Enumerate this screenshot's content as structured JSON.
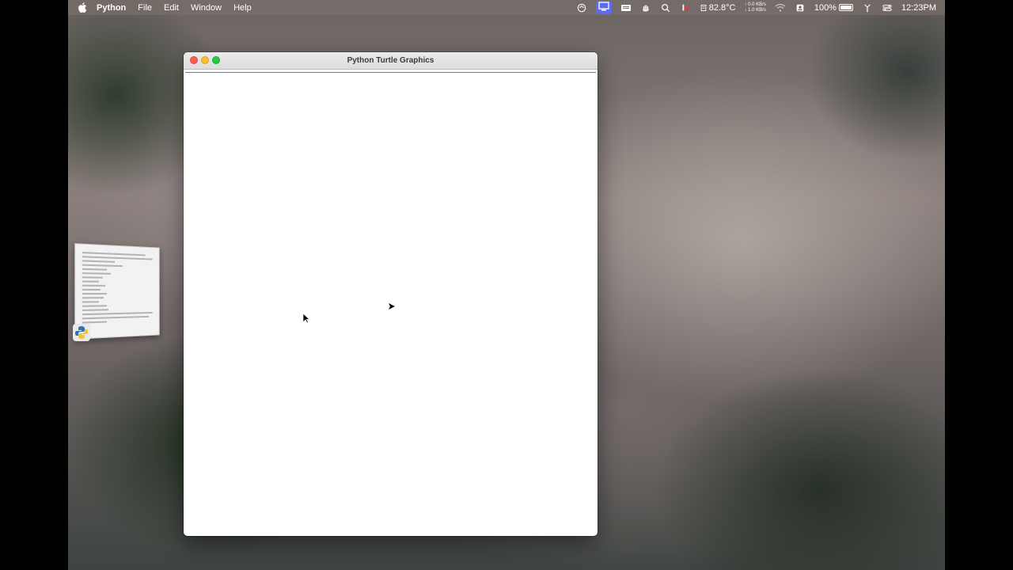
{
  "menubar": {
    "app_name": "Python",
    "menus": [
      "File",
      "Edit",
      "Window",
      "Help"
    ],
    "temperature": "82.8°C",
    "net_up": "↑ 0.0 KB/s",
    "net_down": "↓ 1.0 KB/s",
    "battery_percent": "100%",
    "clock": "12:23PM",
    "icons": [
      "apple-icon",
      "sync-icon",
      "display-icon",
      "keyboard-icon",
      "hand-icon",
      "search-icon",
      "mic-icon",
      "cpu-icon",
      "wifi-icon",
      "share-icon",
      "battery-icon",
      "antenna-icon",
      "control-center-icon"
    ]
  },
  "window": {
    "title": "Python Turtle Graphics"
  },
  "colors": {
    "close": "#fc5f57",
    "minimize": "#fdbc2e",
    "maximize": "#28c840",
    "accent": "#5b6cf0"
  }
}
